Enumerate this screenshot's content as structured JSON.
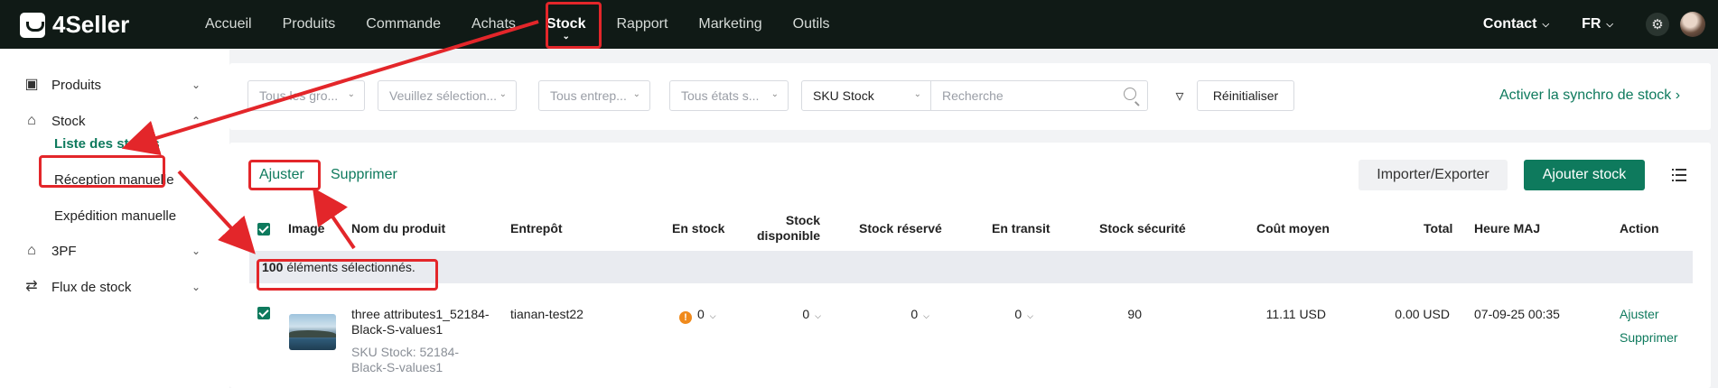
{
  "app": {
    "brand": "4Seller"
  },
  "nav": {
    "items": [
      "Accueil",
      "Produits",
      "Commande",
      "Achats",
      "Stock",
      "Rapport",
      "Marketing",
      "Outils"
    ],
    "active": "Stock",
    "contact": "Contact",
    "language": "FR"
  },
  "sidebar": {
    "produits": "Produits",
    "stock": "Stock",
    "stock_items": [
      "Liste des stocks",
      "Réception manuelle",
      "Expédition manuelle"
    ],
    "tpf": "3PF",
    "flux": "Flux de stock"
  },
  "filters": {
    "group": "Tous les gro...",
    "select": "Veuillez sélection...",
    "warehouse": "Tous entrep...",
    "state": "Tous états s...",
    "search_type": "SKU Stock",
    "search_placeholder": "Recherche",
    "reset": "Réinitialiser",
    "sync_link": "Activer la synchro de stock"
  },
  "toolbar": {
    "adjust": "Ajuster",
    "delete": "Supprimer",
    "import_export": "Importer/Exporter",
    "add_stock": "Ajouter stock"
  },
  "table": {
    "headers": {
      "image": "Image",
      "product": "Nom du produit",
      "warehouse": "Entrepôt",
      "in_stock": "En stock",
      "available_1": "Stock",
      "available_2": "disponible",
      "reserved": "Stock réservé",
      "in_transit": "En transit",
      "safety": "Stock sécurité",
      "avg_cost": "Coût moyen",
      "total": "Total",
      "updated": "Heure MAJ",
      "action": "Action"
    },
    "selection": {
      "count": "100",
      "text": "éléments sélectionnés."
    },
    "rows": [
      {
        "name_1": "three attributes1_52184-",
        "name_2": "Black-S-values1",
        "sku_1": "SKU Stock: 52184-",
        "sku_2": "Black-S-values1",
        "warehouse": "tianan-test22",
        "in_stock": "0",
        "available": "0",
        "reserved": "0",
        "in_transit": "0",
        "safety": "90",
        "avg_cost": "11.11 USD",
        "total": "0.00 USD",
        "updated": "07-09-25 00:35",
        "action_adjust": "Ajuster",
        "action_delete": "Supprimer"
      }
    ]
  },
  "colors": {
    "accent": "#0e7a5d",
    "topbar": "#101a16",
    "annotation": "#e3262a"
  }
}
